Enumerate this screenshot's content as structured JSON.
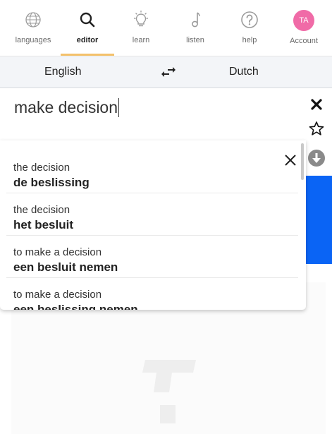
{
  "nav": {
    "items": [
      {
        "label": "languages",
        "icon": "globe-icon"
      },
      {
        "label": "editor",
        "icon": "search-icon",
        "active": true
      },
      {
        "label": "learn",
        "icon": "lightbulb-icon"
      },
      {
        "label": "listen",
        "icon": "music-note-icon"
      },
      {
        "label": "help",
        "icon": "help-circle-icon"
      }
    ],
    "account": {
      "initials": "TA",
      "label": "Account",
      "color": "#f06ba7"
    },
    "active_underline_color": "#f3c16b"
  },
  "langbar": {
    "source": "English",
    "target": "Dutch",
    "swap_icon": "swap-arrows-icon"
  },
  "input": {
    "value": "make decision"
  },
  "side_actions": [
    {
      "icon": "close-x-icon"
    },
    {
      "icon": "star-outline-icon"
    },
    {
      "icon": "download-circle-icon"
    }
  ],
  "suggestions": [
    {
      "source": "the decision",
      "target": "de beslissing"
    },
    {
      "source": "the decision",
      "target": "het besluit"
    },
    {
      "source": "to make a decision",
      "target": "een besluit nemen"
    },
    {
      "source": "to make a decision",
      "target": "een beslissing nemen"
    }
  ],
  "colors": {
    "accent_blue": "#0a64f5",
    "langbar_bg": "#f3f5f8"
  }
}
